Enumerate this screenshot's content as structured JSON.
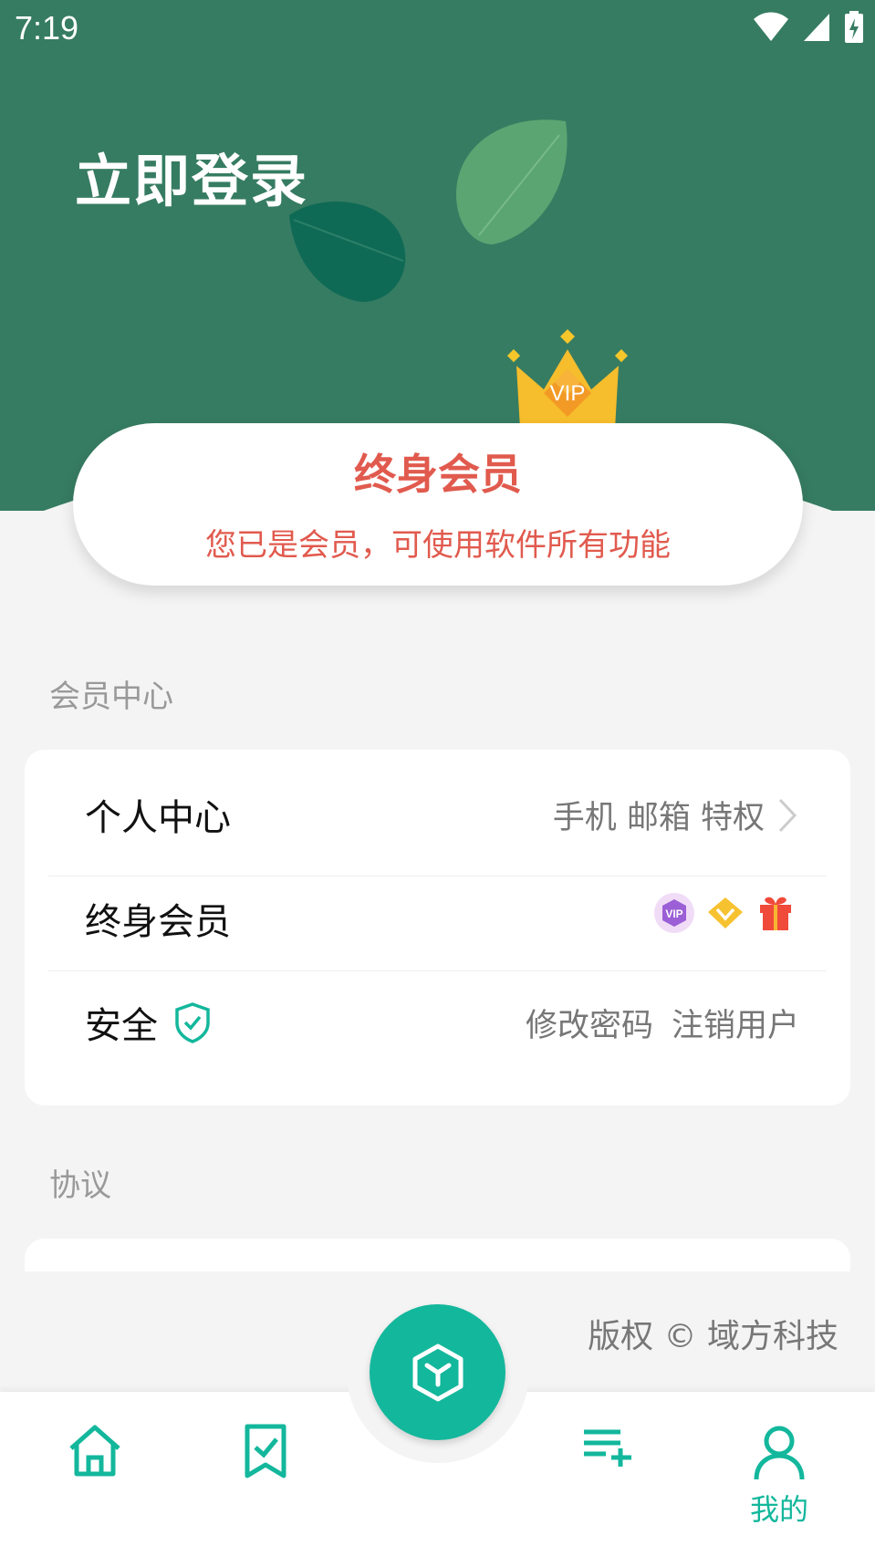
{
  "status_bar": {
    "time": "7:19"
  },
  "header": {
    "login_label": "立即登录"
  },
  "vip_card": {
    "badge_text": "VIP",
    "title": "终身会员",
    "subtitle": "您已是会员，可使用软件所有功能"
  },
  "sections": {
    "member_center_label": "会员中心",
    "agreement_label": "协议"
  },
  "member_rows": {
    "personal": {
      "label": "个人中心",
      "detail": "手机 邮箱 特权"
    },
    "lifetime": {
      "label": "终身会员",
      "badge_text": "VIP"
    },
    "security": {
      "label": "安全",
      "change_password": "修改密码",
      "deregister": "注销用户"
    }
  },
  "footer": {
    "copyright": "版权 © 域方科技"
  },
  "bottom_nav": {
    "items": [
      {
        "icon": "home-icon"
      },
      {
        "icon": "bookmark-check-icon"
      },
      {
        "icon": "cube-icon"
      },
      {
        "icon": "playlist-add-icon"
      },
      {
        "icon": "person-icon",
        "label": "我的"
      }
    ]
  },
  "colors": {
    "header_green": "#367c62",
    "accent_teal": "#13b79c",
    "vip_red": "#e15a4e"
  }
}
